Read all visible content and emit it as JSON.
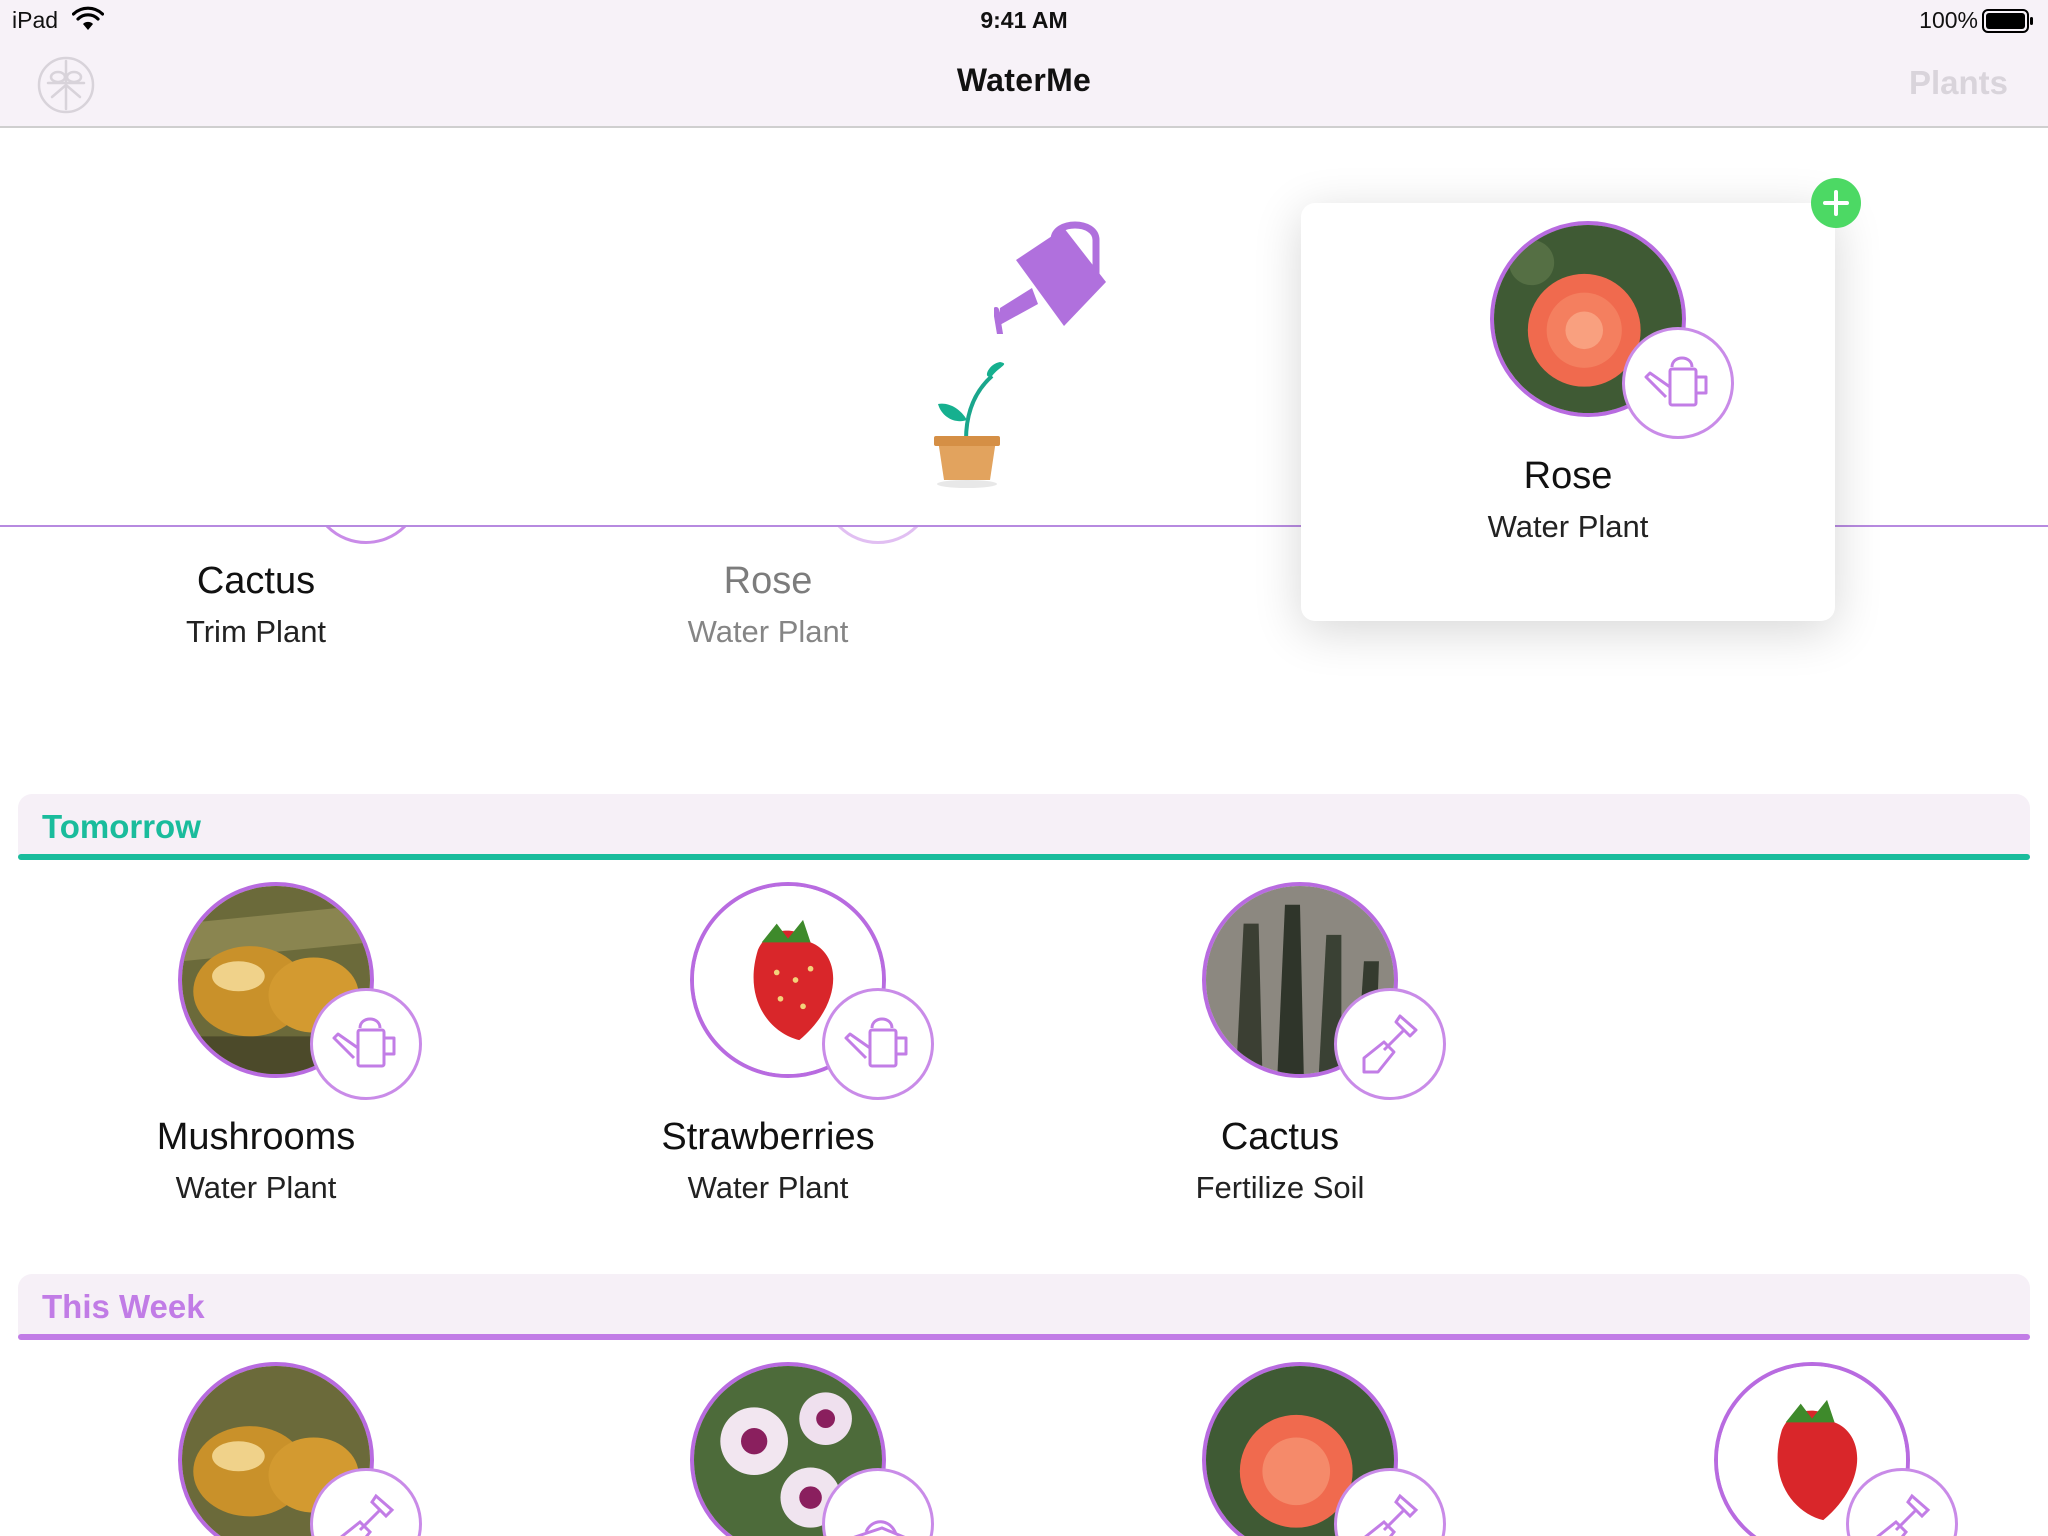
{
  "status_bar": {
    "device": "iPad",
    "time": "9:41 AM",
    "battery": "100%"
  },
  "nav": {
    "title": "WaterMe",
    "right_button": "Plants",
    "left_icon": "settings-flower-icon"
  },
  "colors": {
    "accent": "#b86be0",
    "tomorrow": "#1abc9c",
    "this_week": "#c17ce6",
    "add": "#4cd964"
  },
  "today_partial": [
    {
      "name": "Cactus",
      "task": "Trim Plant",
      "photo": "cactus",
      "icon": "scissors-icon"
    },
    {
      "name": "Rose",
      "task": "Water Plant",
      "photo": "rose",
      "icon": "watering-can-icon"
    }
  ],
  "drag_preview": {
    "name": "Rose",
    "task": "Water Plant",
    "photo": "rose",
    "icon": "watering-can-icon"
  },
  "sections": {
    "tomorrow": {
      "title": "Tomorrow",
      "items": [
        {
          "name": "Mushrooms",
          "task": "Water Plant",
          "photo": "mushrooms",
          "icon": "watering-can-icon"
        },
        {
          "name": "Strawberries",
          "task": "Water Plant",
          "photo": "strawberry",
          "icon": "watering-can-icon"
        },
        {
          "name": "Cactus",
          "task": "Fertilize Soil",
          "photo": "cactus",
          "icon": "shovel-icon"
        }
      ]
    },
    "this_week": {
      "title": "This Week",
      "items": [
        {
          "photo": "mushrooms",
          "icon": "shovel-icon"
        },
        {
          "photo": "petunia",
          "icon": "fertilizer-icon"
        },
        {
          "photo": "rose",
          "icon": "shovel-icon"
        },
        {
          "photo": "strawberry",
          "icon": "shovel-icon"
        }
      ]
    }
  }
}
